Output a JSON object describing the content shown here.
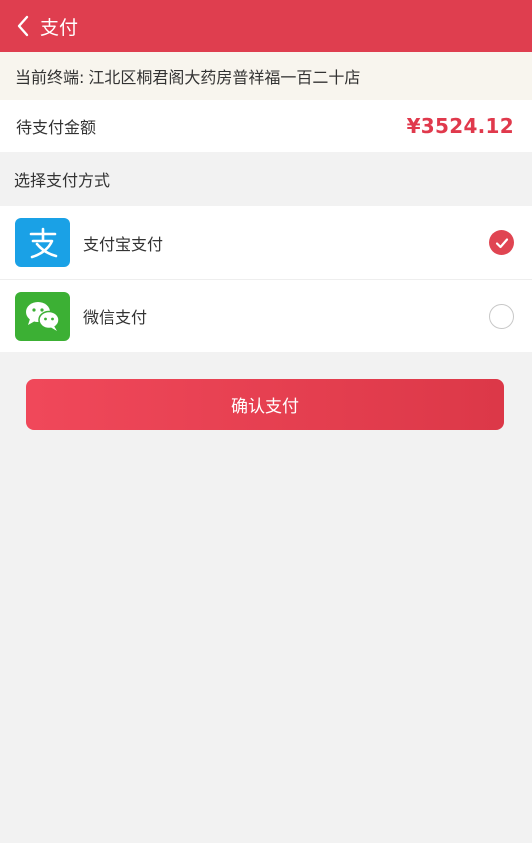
{
  "header": {
    "title": "支付",
    "back_icon": "chevron-left-icon"
  },
  "terminal": {
    "label": "当前终端:",
    "name": "江北区桐君阁大药房普祥福一百二十店"
  },
  "amount": {
    "label": "待支付金额",
    "value": "¥3524.12"
  },
  "payment": {
    "section_label": "选择支付方式",
    "options": [
      {
        "name": "支付宝支付",
        "icon": "alipay-icon",
        "selected": true
      },
      {
        "name": "微信支付",
        "icon": "wechat-icon",
        "selected": false
      }
    ]
  },
  "confirm_label": "确认支付",
  "colors": {
    "header_bg": "#df3e4f",
    "accent": "#e0394c",
    "alipay": "#1aa1e6",
    "wechat": "#3cb034"
  }
}
